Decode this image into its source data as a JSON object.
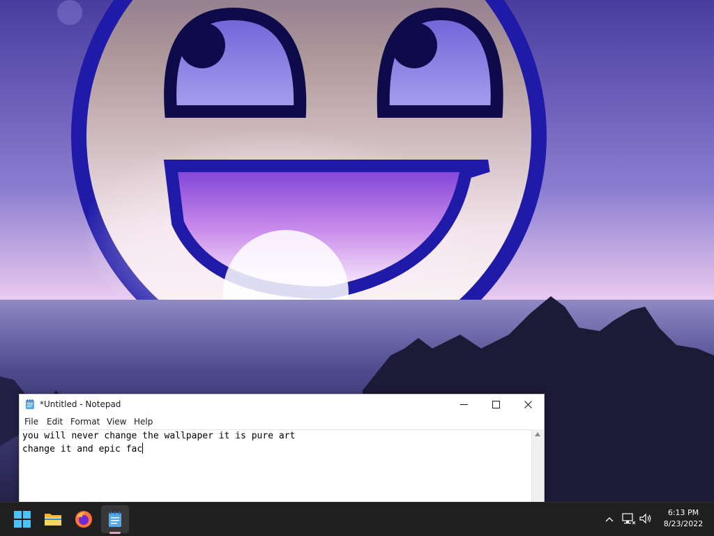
{
  "wallpaper": {
    "description_icon": "awesome-face-wallpaper",
    "colors": {
      "sky_top": "#4b3aa3",
      "sky_horizon": "#f4d8f2",
      "face_outline": "#1f1aa8",
      "mountains": "#1c1a38"
    }
  },
  "notepad": {
    "title": "*Untitled - Notepad",
    "app_icon": "notepad-icon",
    "controls": {
      "minimize_icon": "minimize-icon",
      "maximize_icon": "maximize-icon",
      "close_icon": "close-icon"
    },
    "menu": {
      "file": "File",
      "edit": "Edit",
      "format": "Format",
      "view": "View",
      "help": "Help"
    },
    "content": {
      "line1": "you will never change the wallpaper it is pure art",
      "line2": "change it and epic fac"
    }
  },
  "taskbar": {
    "pinned": [
      {
        "name": "start",
        "icon": "windows-start-icon"
      },
      {
        "name": "file-explorer",
        "icon": "folder-icon"
      },
      {
        "name": "firefox",
        "icon": "firefox-icon"
      },
      {
        "name": "notepad",
        "icon": "notepad-icon",
        "active": true
      }
    ],
    "tray": {
      "overflow_icon": "chevron-up-icon",
      "network_icon": "network-icon",
      "volume_icon": "volume-icon"
    },
    "clock": {
      "time": "6:13 PM",
      "date": "8/23/2022"
    },
    "colors": {
      "background": "#202020",
      "active_indicator": "#e8a1c6"
    }
  }
}
